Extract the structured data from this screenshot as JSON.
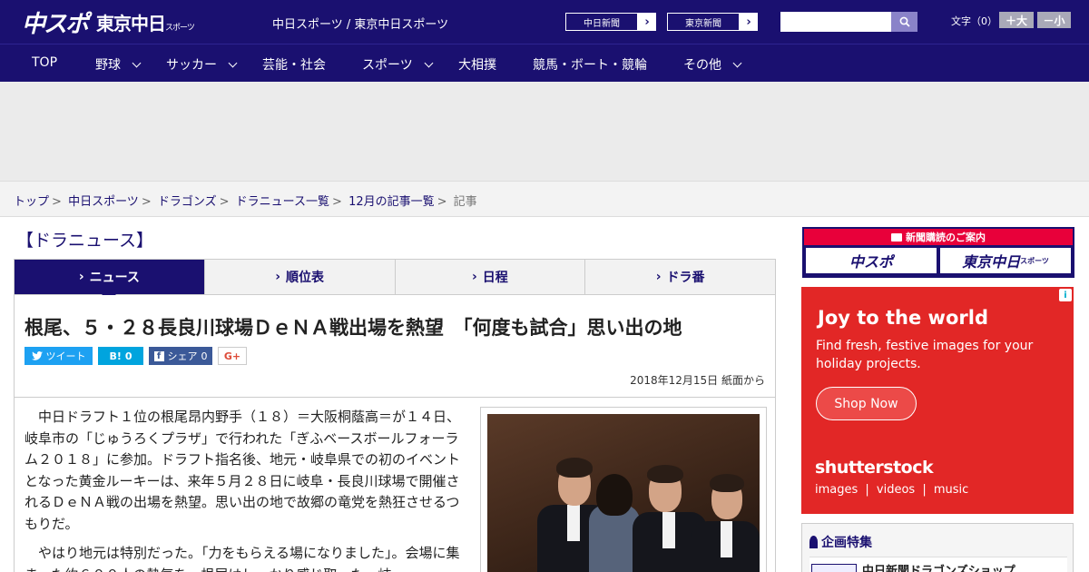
{
  "header": {
    "logo_main": "中スポ",
    "logo_tokyo": "東京中日",
    "logo_tokyo_small": "スポーツ",
    "site_label": "中日スポーツ / 東京中日スポーツ",
    "links": [
      {
        "label": "中日新聞"
      },
      {
        "label": "東京新聞"
      }
    ],
    "search_placeholder": "",
    "font_label": "文字（0）",
    "font_larger": "＋大",
    "font_smaller": "－小"
  },
  "nav": {
    "items": [
      {
        "label": "TOP",
        "dropdown": false
      },
      {
        "label": "野球",
        "dropdown": true
      },
      {
        "label": "サッカー",
        "dropdown": true
      },
      {
        "label": "芸能・社会",
        "dropdown": false
      },
      {
        "label": "スポーツ",
        "dropdown": true
      },
      {
        "label": "大相撲",
        "dropdown": false
      },
      {
        "label": "競馬・ボート・競輪",
        "dropdown": false
      },
      {
        "label": "その他",
        "dropdown": true
      }
    ]
  },
  "breadcrumb": {
    "items": [
      "トップ",
      "中日スポーツ",
      "ドラゴンズ",
      "ドラニュース一覧",
      "12月の記事一覧"
    ],
    "current": "記事"
  },
  "section_title": "【ドラニュース】",
  "tabs": [
    {
      "label": "ニュース",
      "active": true
    },
    {
      "label": "順位表",
      "active": false
    },
    {
      "label": "日程",
      "active": false
    },
    {
      "label": "ドラ番",
      "active": false
    }
  ],
  "article": {
    "headline": "根尾、５・２８長良川球場ＤｅＮＡ戦出場を熱望　「何度も試合」思い出の地",
    "share": {
      "tweet": "ツイート",
      "hatena_count": "0",
      "fb_label": "シェア",
      "fb_count": "0",
      "gplus": "G+"
    },
    "date": "2018年12月15日 紙面から",
    "paragraphs": [
      "中日ドラフト１位の根尾昂内野手（１８）＝大阪桐蔭高＝が１４日、岐阜市の「じゅうろくプラザ」で行われた「ぎふベースボールフォーラム２０１８」に参加。ドラフト指名後、地元・岐阜県での初のイベントとなった黄金ルーキーは、来年５月２８日に岐阜・長良川球場で開催されるＤｅＮＡ戦の出場を熱望。思い出の地で故郷の竜党を熱狂させるつもりだ。",
      "やはり地元は特別だった。「力をもらえる場になりました」。会場に集まった約６００人の熱気を、根尾はしっかり感じ取った。岐"
    ]
  },
  "sidebar": {
    "subscribe_title": "新聞購読のご案内",
    "subscribe_a": "中スポ",
    "subscribe_b": "東京中日",
    "subscribe_b_small": "スポーツ",
    "ad": {
      "headline": "Joy to the world",
      "text": "Find fresh, festive images for your holiday projects.",
      "cta": "Shop Now",
      "brand": "shutterstock",
      "sub": "images | videos | music"
    },
    "feature_title": "企画特集",
    "feature_item": "中日新聞ドラゴンズショップ"
  }
}
